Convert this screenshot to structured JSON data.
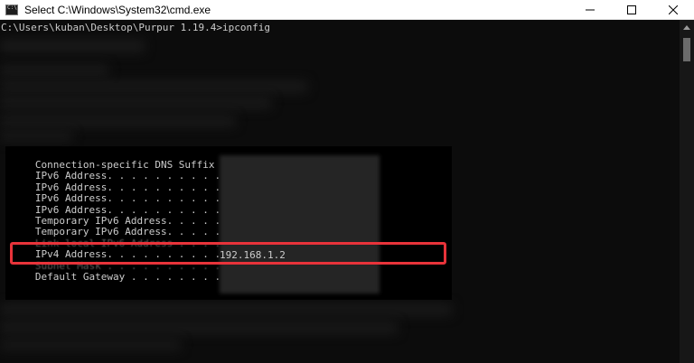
{
  "window": {
    "title": "Select C:\\Windows\\System32\\cmd.exe",
    "icon": "cmd-icon",
    "controls": {
      "minimize": "minimize-icon",
      "maximize": "maximize-icon",
      "close": "close-icon"
    }
  },
  "console": {
    "prompt": "C:\\Users\\kuban\\Desktop\\Purpur 1.19.4>ipconfig",
    "rows": [
      {
        "key": "   Connection-specific DNS Suffix  . :",
        "value": ""
      },
      {
        "key": "   IPv6 Address. . . . . . . . . . . :",
        "value": ""
      },
      {
        "key": "   IPv6 Address. . . . . . . . . . . :",
        "value": ""
      },
      {
        "key": "   IPv6 Address. . . . . . . . . . . :",
        "value": ""
      },
      {
        "key": "   IPv6 Address. . . . . . . . . . . :",
        "value": ""
      },
      {
        "key": "   Temporary IPv6 Address. . . . . . :",
        "value": ""
      },
      {
        "key": "   Temporary IPv6 Address. . . . . . :",
        "value": ""
      },
      {
        "key": "   Link-local IPv6 Address . . . . . :",
        "value": ""
      },
      {
        "key": "   IPv4 Address. . . . . . . . . . . :",
        "value": ""
      },
      {
        "key": "   Subnet Mask . . . . . . . . . . . :",
        "value": ""
      },
      {
        "key": "   Default Gateway . . . . . . . . . :",
        "value": ""
      }
    ],
    "ipv4_value": "192.168.1.2"
  },
  "colors": {
    "background": "#0c0c0c",
    "text": "#cccccc",
    "highlight": "#e8333a"
  }
}
